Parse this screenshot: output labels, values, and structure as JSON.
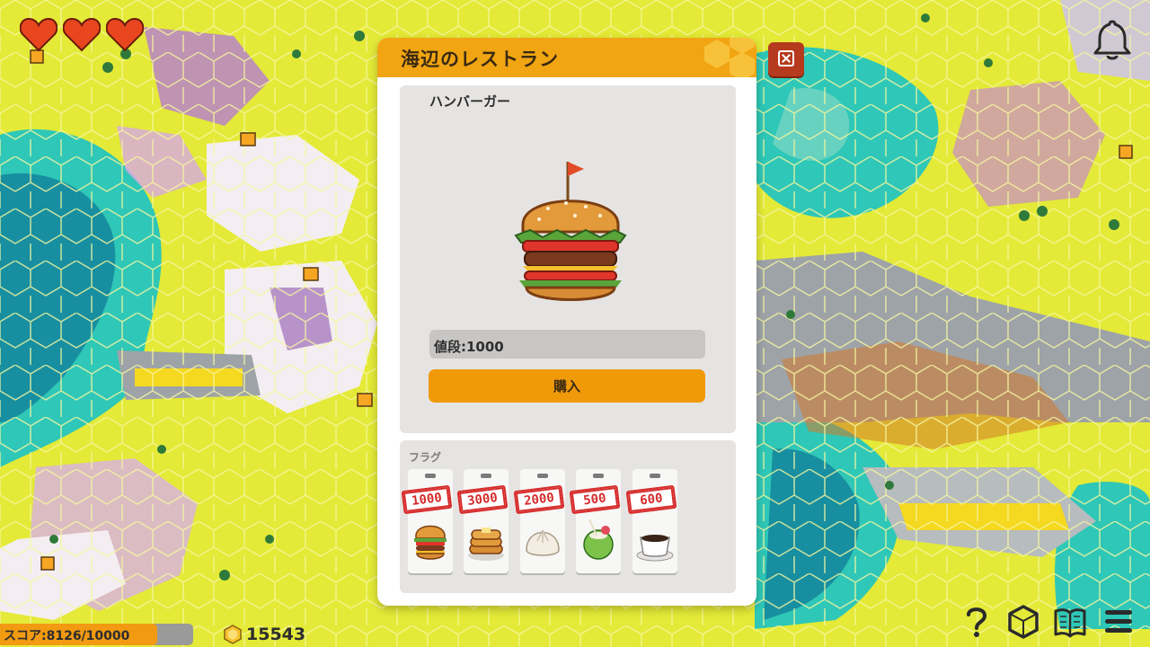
{
  "hud": {
    "lives": 3,
    "score_label": "スコア:8126/10000",
    "score_progress": 0.8126,
    "coins": "15543",
    "icons": [
      "heart-icon",
      "bell-icon",
      "help-icon",
      "hexagon-icon",
      "book-icon",
      "menu-icon"
    ]
  },
  "dialog": {
    "title": "海辺のレストラン",
    "item_name": "ハンバーガー",
    "item_icon": "hamburger-icon",
    "price_label": "値段:1000",
    "buy_label": "購入",
    "flags_label": "フラグ",
    "items": [
      {
        "price": "1000",
        "icon": "hamburger-icon"
      },
      {
        "price": "3000",
        "icon": "pancake-icon"
      },
      {
        "price": "2000",
        "icon": "steamed-bun-icon"
      },
      {
        "price": "500",
        "icon": "coconut-drink-icon"
      },
      {
        "price": "600",
        "icon": "coffee-icon"
      }
    ]
  },
  "colors": {
    "accent": "#f1a512",
    "buy_button": "#f09a0a",
    "close_button": "#b63b1e",
    "price_tag": "#d62c2c"
  }
}
